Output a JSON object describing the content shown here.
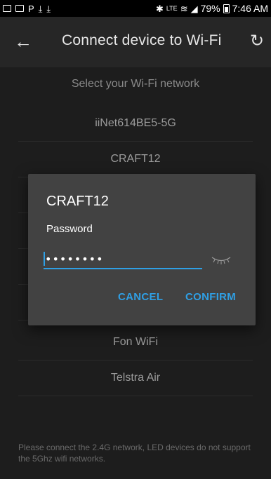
{
  "status_bar": {
    "battery": "79%",
    "time": "7:46 AM",
    "network": "LTE"
  },
  "app_bar": {
    "title": "Connect device to Wi-Fi",
    "back_icon": "back-arrow-icon",
    "refresh_icon": "refresh-icon"
  },
  "list": {
    "header": "Select your Wi-Fi network",
    "networks": [
      "iiNet614BE5-5G",
      "CRAFT12",
      "Fon WiFi",
      "Telstra Air"
    ]
  },
  "footer_note": "Please connect the 2.4G network, LED devices do not support the 5Ghz wifi networks.",
  "dialog": {
    "title": "CRAFT12",
    "field_label": "Password",
    "password_value": "••••••••",
    "cancel_label": "CANCEL",
    "confirm_label": "CONFIRM",
    "accent_color": "#2f9fe4",
    "eye_icon": "eye-closed-icon"
  }
}
